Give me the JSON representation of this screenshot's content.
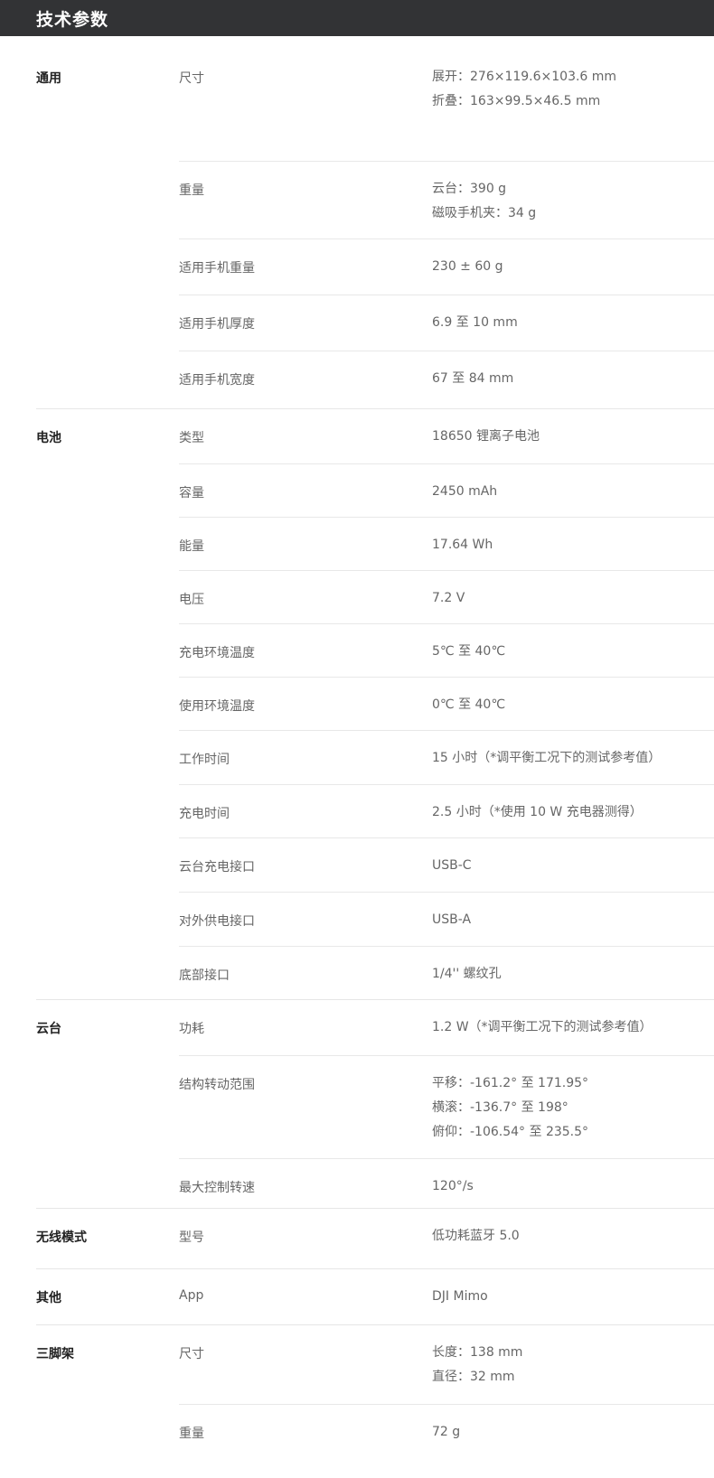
{
  "header": {
    "title": "技术参数"
  },
  "sections": [
    {
      "category": "通用",
      "rows": [
        {
          "label": "尺寸",
          "values": [
            "展开：276×119.6×103.6 mm",
            "折叠：163×99.5×46.5 mm"
          ]
        },
        {
          "label": "重量",
          "values": [
            "云台：390 g",
            "磁吸手机夹：34 g"
          ]
        },
        {
          "label": "适用手机重量",
          "values": [
            "230 ± 60 g"
          ]
        },
        {
          "label": "适用手机厚度",
          "values": [
            "6.9 至 10 mm"
          ]
        },
        {
          "label": "适用手机宽度",
          "values": [
            "67 至 84 mm"
          ]
        }
      ]
    },
    {
      "category": "电池",
      "rows": [
        {
          "label": "类型",
          "values": [
            "18650 锂离子电池"
          ]
        },
        {
          "label": "容量",
          "values": [
            "2450 mAh"
          ]
        },
        {
          "label": "能量",
          "values": [
            "17.64 Wh"
          ]
        },
        {
          "label": "电压",
          "values": [
            "7.2 V"
          ]
        },
        {
          "label": "充电环境温度",
          "values": [
            "5℃ 至 40℃"
          ]
        },
        {
          "label": "使用环境温度",
          "values": [
            "0℃ 至 40℃"
          ]
        },
        {
          "label": "工作时间",
          "values": [
            "15 小时（*调平衡工况下的测试参考值）"
          ]
        },
        {
          "label": "充电时间",
          "values": [
            "2.5 小时（*使用 10 W 充电器测得）"
          ]
        },
        {
          "label": "云台充电接口",
          "values": [
            "USB-C"
          ]
        },
        {
          "label": "对外供电接口",
          "values": [
            "USB-A"
          ]
        },
        {
          "label": "底部接口",
          "values": [
            "1/4'' 螺纹孔"
          ]
        }
      ]
    },
    {
      "category": "云台",
      "rows": [
        {
          "label": "功耗",
          "values": [
            "1.2 W（*调平衡工况下的测试参考值）"
          ]
        },
        {
          "label": "结构转动范围",
          "values": [
            "平移：-161.2° 至 171.95°",
            "横滚：-136.7° 至 198°",
            "俯仰：-106.54° 至 235.5°"
          ]
        },
        {
          "label": "最大控制转速",
          "values": [
            "120°/s"
          ]
        }
      ]
    },
    {
      "category": "无线模式",
      "rows": [
        {
          "label": "型号",
          "values": [
            "低功耗蓝牙 5.0"
          ]
        }
      ]
    },
    {
      "category": "其他",
      "rows": [
        {
          "label": "App",
          "values": [
            "DJI Mimo"
          ]
        }
      ]
    },
    {
      "category": "三脚架",
      "rows": [
        {
          "label": "尺寸",
          "values": [
            "长度：138 mm",
            "直径：32 mm"
          ]
        },
        {
          "label": "重量",
          "values": [
            "72 g"
          ]
        }
      ]
    }
  ]
}
